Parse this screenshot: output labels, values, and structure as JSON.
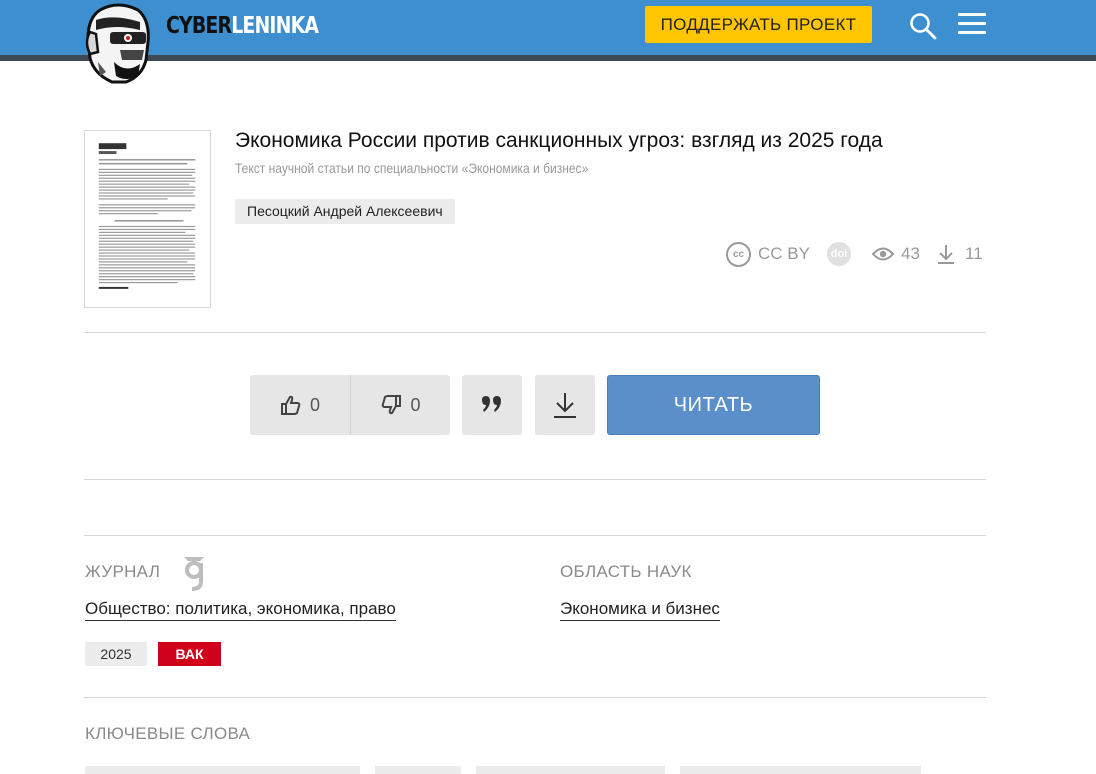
{
  "header": {
    "logo_part1": "CYBER",
    "logo_part2": "LENINKA",
    "support_label": "ПОДДЕРЖАТЬ ПРОЕКТ",
    "search_icon": "search-icon",
    "menu_icon": "hamburger-menu-icon",
    "brand_color": "#3d8fd0",
    "support_color": "#ffc600"
  },
  "article": {
    "title": "Экономика России против санкционных угроз: взгляд из 2025 года",
    "subtitle": "Текст научной статьи по специальности «Экономика и бизнес»",
    "author": "Песоцкий Андрей Алексеевич",
    "license_icon_text": "cc",
    "license": "CC BY",
    "doi_icon_text": "doi",
    "views": "43",
    "downloads": "11"
  },
  "actions": {
    "likes": "0",
    "dislikes": "0",
    "read_label": "ЧИТАТЬ",
    "read_color": "#5a8fca"
  },
  "info": {
    "journal_label": "ЖУРНАЛ",
    "journal_name": "Общество: политика, экономика, право",
    "field_label": "ОБЛАСТЬ НАУК",
    "field_name": "Экономика и бизнес",
    "year": "2025",
    "vak": "ВАК",
    "vak_color": "#d0021b"
  },
  "keywords": {
    "label": "КЛЮЧЕВЫЕ СЛОВА"
  }
}
